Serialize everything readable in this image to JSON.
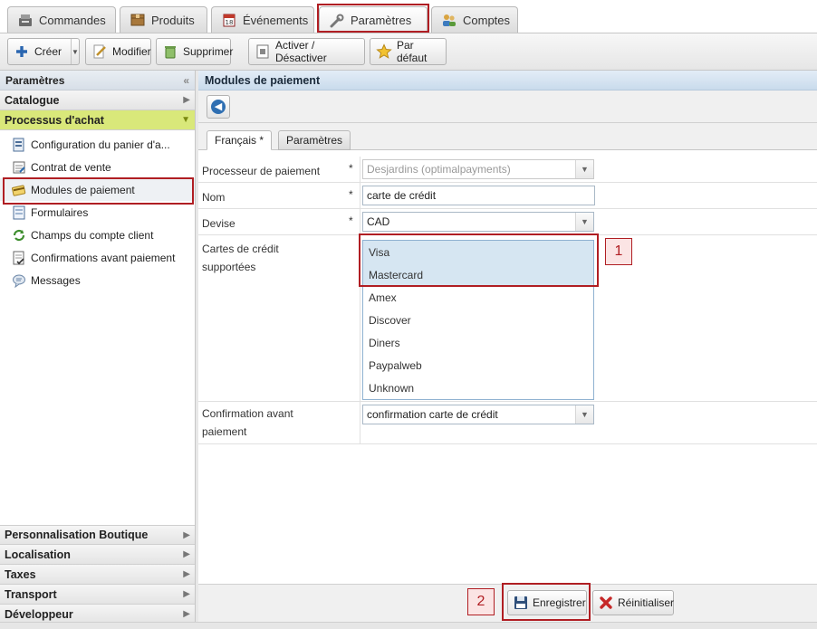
{
  "top_tabs": [
    {
      "label": "Commandes",
      "icon": "cash-register-icon"
    },
    {
      "label": "Produits",
      "icon": "box-icon"
    },
    {
      "label": "Événements",
      "icon": "calendar-icon"
    },
    {
      "label": "Paramètres",
      "icon": "wrench-icon",
      "active": true
    },
    {
      "label": "Comptes",
      "icon": "users-icon"
    }
  ],
  "toolbar": {
    "create": "Créer",
    "edit": "Modifier",
    "delete": "Supprimer",
    "toggle": "Activer / Désactiver",
    "default": "Par défaut"
  },
  "sidebar": {
    "title": "Paramètres",
    "sections_top": [
      "Catalogue",
      "Processus d'achat"
    ],
    "items": [
      {
        "label": "Configuration du panier d'a...",
        "icon": "cart-config-icon"
      },
      {
        "label": "Contrat de vente",
        "icon": "contract-icon"
      },
      {
        "label": "Modules de paiement",
        "icon": "payment-module-icon"
      },
      {
        "label": "Formulaires",
        "icon": "form-icon"
      },
      {
        "label": "Champs du compte client",
        "icon": "refresh-fields-icon"
      },
      {
        "label": "Confirmations avant paiement",
        "icon": "confirmation-icon"
      },
      {
        "label": "Messages",
        "icon": "message-icon"
      }
    ],
    "sections_bottom": [
      "Personnalisation Boutique",
      "Localisation",
      "Taxes",
      "Transport",
      "Développeur"
    ]
  },
  "main": {
    "title": "Modules de paiement",
    "form_tabs": [
      "Français *",
      "Paramètres"
    ],
    "fields": {
      "processor_label": "Processeur de paiement",
      "processor_value": "Desjardins (optimalpayments)",
      "name_label": "Nom",
      "name_value": "carte de crédit",
      "currency_label": "Devise",
      "currency_value": "CAD",
      "cards_label_1": "Cartes de crédit",
      "cards_label_2": "supportées",
      "cards": [
        "Visa",
        "Mastercard",
        "Amex",
        "Discover",
        "Diners",
        "Paypalweb",
        "Unknown"
      ],
      "cards_selected": [
        "Visa",
        "Mastercard"
      ],
      "confirm_label_1": "Confirmation avant",
      "confirm_label_2": "paiement",
      "confirm_value": "confirmation carte de crédit",
      "required_mark": "*"
    },
    "badges": [
      "1",
      "2"
    ]
  },
  "footer": {
    "save": "Enregistrer",
    "reset": "Réinitialiser"
  },
  "colors": {
    "accent_red": "#b01e23",
    "active_section": "#d9e87a",
    "selection_blue": "#d6e6f2"
  }
}
